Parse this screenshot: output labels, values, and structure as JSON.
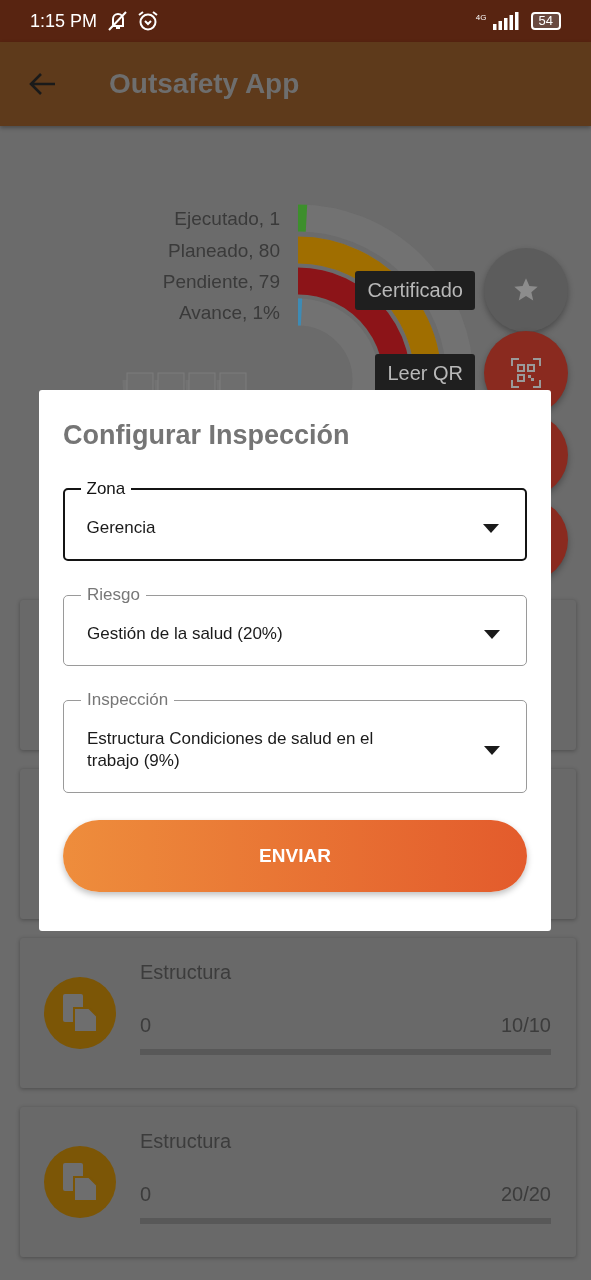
{
  "status_bar": {
    "time": "1:15 PM",
    "network": "4G",
    "battery": "54"
  },
  "app_bar": {
    "title": "Outsafety App"
  },
  "progress_chart": {
    "items": [
      {
        "label": "Ejecutado, 1",
        "color": "#3d8f2c"
      },
      {
        "label": "Planeado, 80",
        "color": "#a06e00"
      },
      {
        "label": "Pendiente, 79",
        "color": "#8c1418"
      },
      {
        "label": "Avance, 1%",
        "color": "#3d8bb5"
      }
    ]
  },
  "fab_menu": [
    {
      "kind": "star",
      "tooltip": "Certificado"
    },
    {
      "kind": "qr",
      "tooltip": "Leer QR"
    },
    {
      "kind": "plain"
    },
    {
      "kind": "plain"
    }
  ],
  "cards": [
    {
      "title": "Estructura",
      "count": "0",
      "total": "10/10",
      "level": 0
    },
    {
      "title": "Estructura",
      "count": "0",
      "total": "20/20",
      "level": 0
    }
  ],
  "dialog": {
    "title": "Configurar Inspección",
    "fields": [
      {
        "label": "Zona",
        "value": "Gerencia",
        "focused": true
      },
      {
        "label": "Riesgo",
        "value": "Gestión de la salud (20%)",
        "focused": false
      },
      {
        "label": "Inspección",
        "value": "Estructura Condiciones de salud en el trabajo (9%)",
        "focused": false
      }
    ],
    "submit": "ENVIAR"
  }
}
